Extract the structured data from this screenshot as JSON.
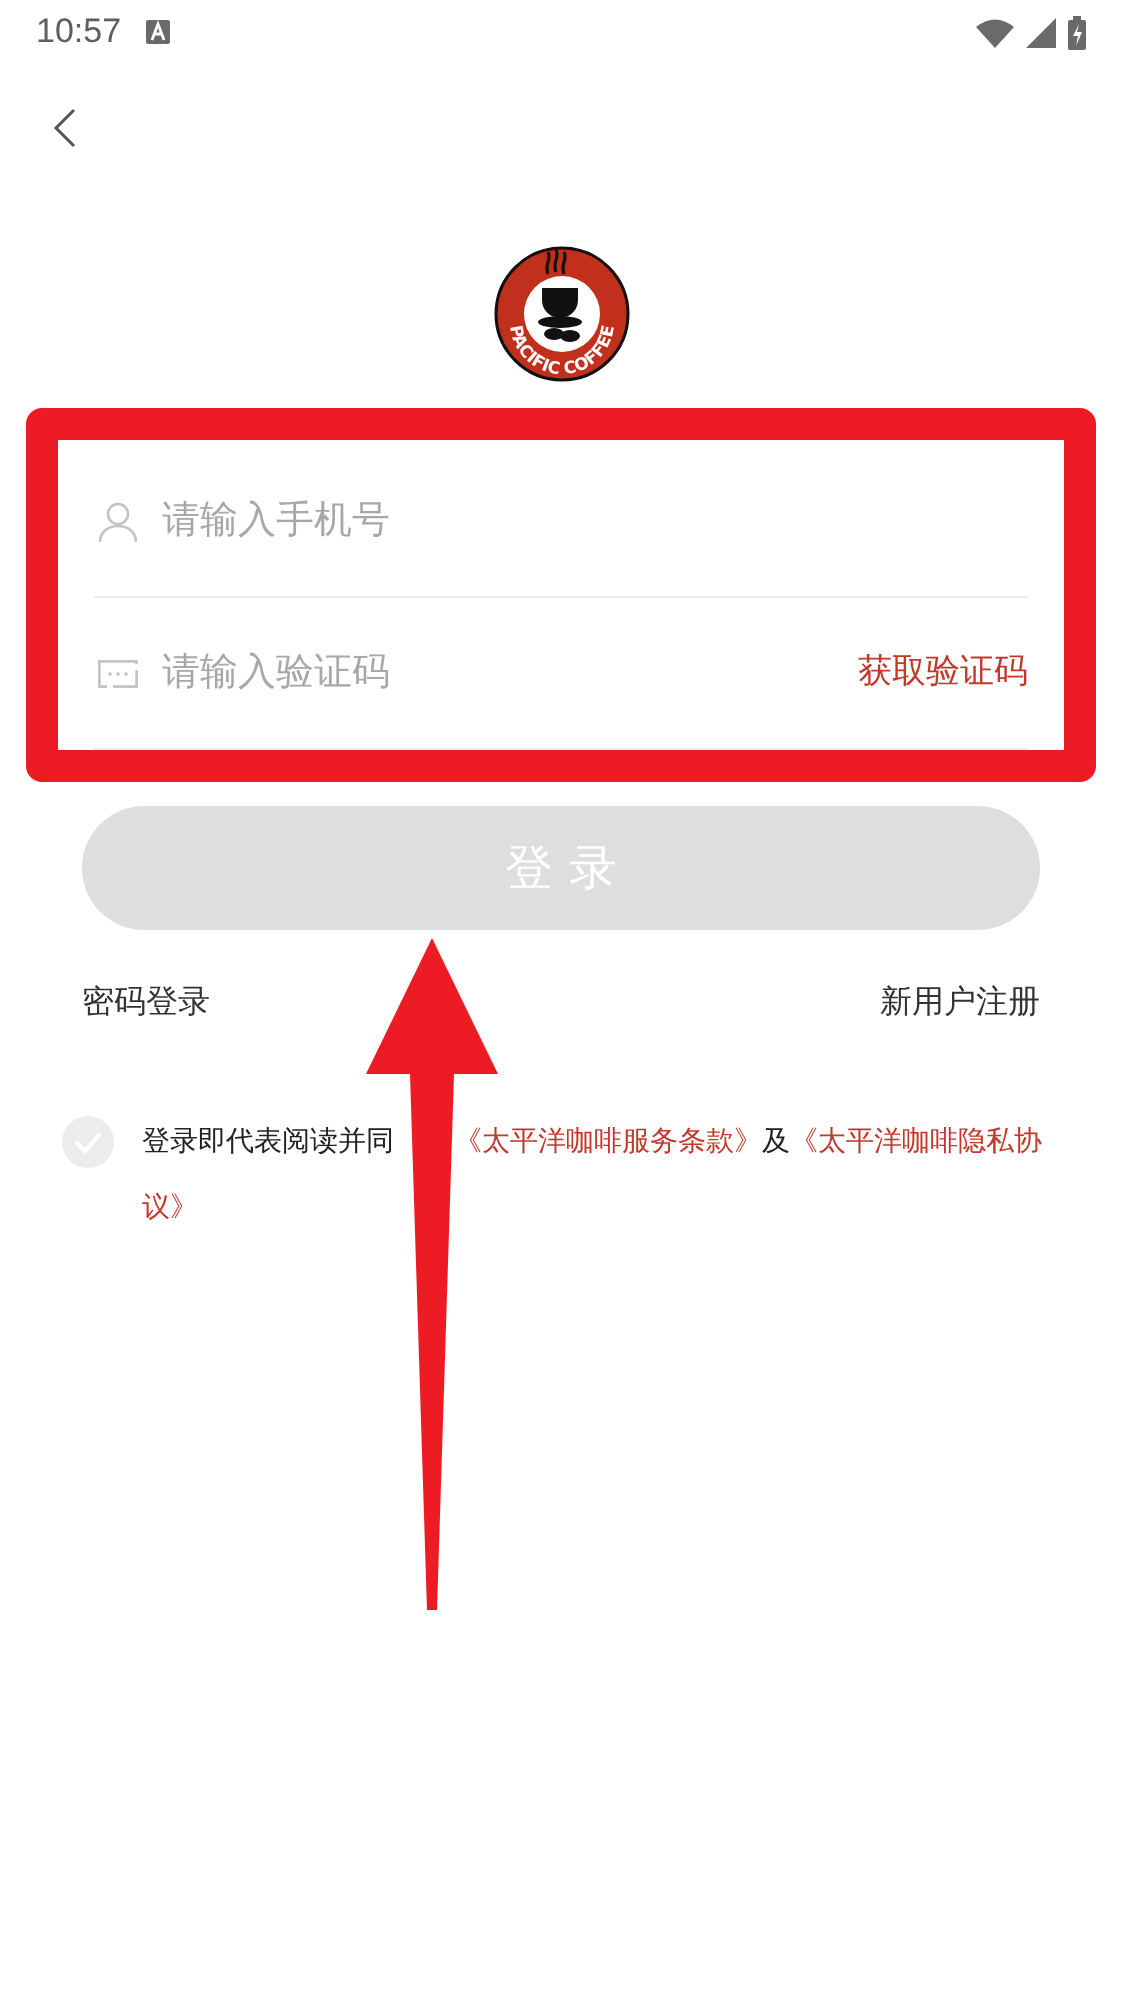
{
  "status_bar": {
    "time": "10:57"
  },
  "logo": {
    "text": "PACIFIC COFFEE"
  },
  "form": {
    "fields": [
      {
        "kind": "phone",
        "placeholder": "请输入手机号"
      },
      {
        "kind": "code",
        "placeholder": "请输入验证码",
        "action": "获取验证码"
      }
    ],
    "login_button": {
      "label": "登 录",
      "disabled": true
    }
  },
  "links": {
    "left": "密码登录",
    "right": "新用户注册"
  },
  "agreement": {
    "checked": false,
    "text": "登录即代表阅读并同",
    "terms_link": "《太平洋咖啡服务条款》",
    "and": "及",
    "privacy_link": [
      "《太平洋咖啡隐私协",
      "议》"
    ]
  }
}
